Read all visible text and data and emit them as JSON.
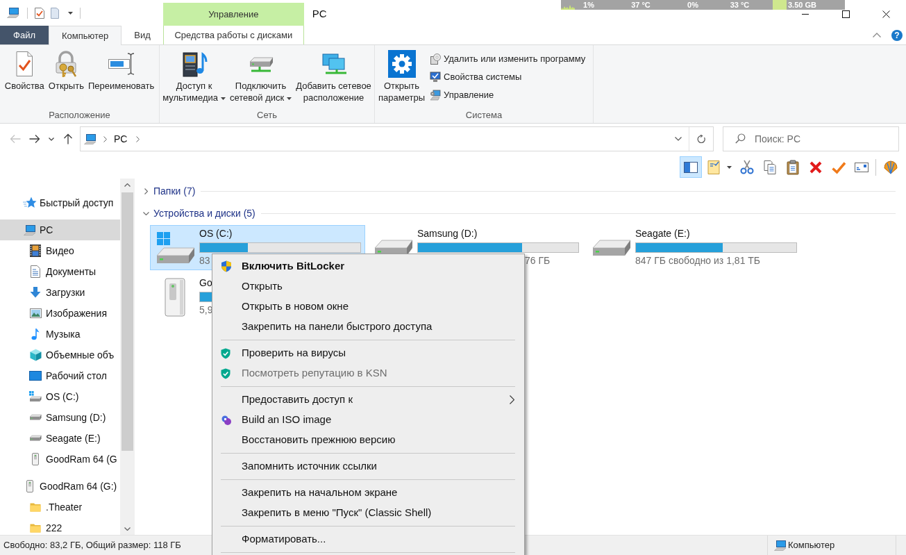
{
  "title_bar": {
    "title": "PC",
    "help": "?"
  },
  "system_monitor": {
    "readings": [
      "1%",
      "37 °C",
      "0%",
      "33 °C",
      "3.50 GB"
    ]
  },
  "ribbon": {
    "tabs": [
      {
        "label": "Файл",
        "kind": "file",
        "selected": false
      },
      {
        "label": "Компьютер",
        "kind": "tab",
        "selected": true
      },
      {
        "label": "Вид",
        "kind": "tab",
        "selected": false
      },
      {
        "label": "Средства работы с дисками",
        "kind": "contextual",
        "header": "Управление",
        "selected": false
      }
    ],
    "groups": [
      {
        "label": "Расположение",
        "buttons": [
          {
            "label": "Свойства",
            "kind": "properties",
            "dropdown": false
          },
          {
            "label": "Открыть",
            "kind": "open",
            "dropdown": false
          },
          {
            "label": "Переименовать",
            "kind": "rename",
            "dropdown": false
          }
        ]
      },
      {
        "label": "Сеть",
        "buttons": [
          {
            "label": "Доступ к\nмультимедиа",
            "kind": "media",
            "dropdown": true
          },
          {
            "label": "Подключить\nсетевой диск",
            "kind": "map-drive",
            "dropdown": true
          },
          {
            "label": "Добавить сетевое\nрасположение",
            "kind": "network-location",
            "dropdown": false
          }
        ]
      },
      {
        "label": "Система",
        "buttons": [
          {
            "label": "Открыть\nпараметры",
            "kind": "settings",
            "dropdown": false
          }
        ],
        "small_buttons": [
          {
            "label": "Удалить или изменить программу",
            "kind": "uninstall"
          },
          {
            "label": "Свойства системы",
            "kind": "system-properties"
          },
          {
            "label": "Управление",
            "kind": "manage"
          }
        ]
      }
    ]
  },
  "navigation": {
    "buttons": [
      {
        "kind": "back",
        "disabled": true
      },
      {
        "kind": "forward",
        "disabled": false
      },
      {
        "kind": "recent",
        "disabled": false
      },
      {
        "kind": "up",
        "disabled": false
      }
    ],
    "breadcrumb": [
      "PC"
    ],
    "search": {
      "placeholder": "Поиск: PC"
    }
  },
  "toolbar": {
    "buttons": [
      {
        "kind": "preview-pane",
        "on": true
      },
      {
        "kind": "properties",
        "on": false
      },
      {
        "kind": "cut",
        "on": false
      },
      {
        "kind": "copy",
        "on": false
      },
      {
        "kind": "paste",
        "on": false
      },
      {
        "kind": "delete",
        "on": false
      },
      {
        "kind": "tick",
        "on": false
      },
      {
        "kind": "envelope",
        "on": false
      },
      {
        "kind": "seashell",
        "on": false
      }
    ]
  },
  "sidebar": {
    "items": [
      {
        "label": "Быстрый доступ",
        "kind": "star",
        "selected": false
      },
      {
        "label": "PC",
        "kind": "computer",
        "selected": true,
        "children": [
          {
            "label": "Видео",
            "kind": "film",
            "selected": false
          },
          {
            "label": "Документы",
            "kind": "document",
            "selected": false
          },
          {
            "label": "Загрузки",
            "kind": "download",
            "selected": false
          },
          {
            "label": "Изображения",
            "kind": "picture",
            "selected": false
          },
          {
            "label": "Музыка",
            "kind": "music",
            "selected": false
          },
          {
            "label": "Объемные объ",
            "kind": "cube",
            "selected": false
          },
          {
            "label": "Рабочий стол",
            "kind": "desktop",
            "selected": false
          },
          {
            "label": "OS (C:)",
            "kind": "system-drive",
            "selected": false
          },
          {
            "label": "Samsung (D:)",
            "kind": "drive",
            "selected": false
          },
          {
            "label": "Seagate (E:)",
            "kind": "drive",
            "selected": false
          },
          {
            "label": "GoodRam 64 (G",
            "kind": "removable",
            "selected": false
          }
        ]
      },
      {
        "label": "GoodRam 64 (G:)",
        "kind": "removable",
        "selected": false,
        "children": [
          {
            "label": ".Theater",
            "kind": "folder",
            "selected": false
          },
          {
            "label": "222",
            "kind": "folder",
            "selected": false
          }
        ]
      }
    ]
  },
  "content": {
    "groups": [
      {
        "label": "Папки (7)",
        "expanded": false
      },
      {
        "label": "Устройства и диски (5)",
        "expanded": true,
        "drives": [
          {
            "name": "OS (C:)",
            "kind": "system-drive",
            "selected": true,
            "level": 0.3,
            "info": "83"
          },
          {
            "name": "Samsung (D:)",
            "kind": "drive",
            "selected": false,
            "level": 0.65,
            "info": "76 ГБ"
          },
          {
            "name": "Seagate (E:)",
            "kind": "drive",
            "selected": false,
            "level": 0.54,
            "info": "847 ГБ свободно из 1,81 ТБ"
          },
          {
            "name": "Go",
            "kind": "removable",
            "selected": false,
            "info": "5,9"
          }
        ]
      }
    ]
  },
  "context_menu": {
    "items": [
      {
        "kind": "uac",
        "label": "Включить BitLocker",
        "default": true,
        "disabled": false,
        "submenu": false
      },
      {
        "kind": "plain",
        "label": "Открыть",
        "default": false,
        "disabled": false,
        "submenu": false
      },
      {
        "kind": "plain",
        "label": "Открыть в новом окне",
        "default": false,
        "disabled": false,
        "submenu": false
      },
      {
        "kind": "plain",
        "label": "Закрепить на панели быстрого доступа",
        "default": false,
        "disabled": false,
        "submenu": false
      },
      {
        "kind": "separator"
      },
      {
        "kind": "antivirus",
        "label": "Проверить на вирусы",
        "default": false,
        "disabled": false,
        "submenu": false
      },
      {
        "kind": "antivirus",
        "label": "Посмотреть репутацию в KSN",
        "default": false,
        "disabled": true,
        "submenu": false
      },
      {
        "kind": "separator"
      },
      {
        "kind": "plain",
        "label": "Предоставить доступ к",
        "default": false,
        "disabled": false,
        "submenu": true
      },
      {
        "kind": "iso",
        "label": "Build an ISO image",
        "default": false,
        "disabled": false,
        "submenu": false
      },
      {
        "kind": "plain",
        "label": "Восстановить прежнюю версию",
        "default": false,
        "disabled": false,
        "submenu": false
      },
      {
        "kind": "separator"
      },
      {
        "kind": "plain",
        "label": "Запомнить источник ссылки",
        "default": false,
        "disabled": false,
        "submenu": false
      },
      {
        "kind": "separator"
      },
      {
        "kind": "plain",
        "label": "Закрепить на начальном экране",
        "default": false,
        "disabled": false,
        "submenu": false
      },
      {
        "kind": "plain",
        "label": "Закрепить в меню \"Пуск\" (Classic Shell)",
        "default": false,
        "disabled": false,
        "submenu": false
      },
      {
        "kind": "separator"
      },
      {
        "kind": "plain",
        "label": "Форматировать...",
        "default": false,
        "disabled": false,
        "submenu": false
      },
      {
        "kind": "separator"
      }
    ]
  },
  "status_bar": {
    "info": "Свободно: 83,2 ГБ, Общий размер: 118 ГБ",
    "view": "Компьютер"
  }
}
